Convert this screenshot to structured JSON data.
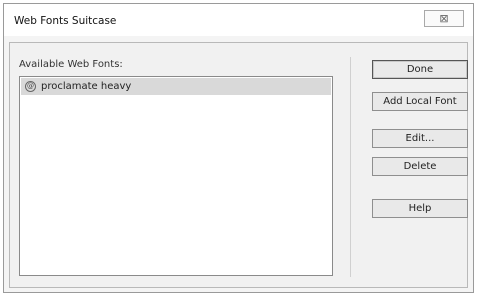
{
  "window": {
    "title": "Web Fonts Suitcase",
    "close_glyph": "⊠"
  },
  "list": {
    "label": "Available Web Fonts:",
    "items": [
      {
        "label": "proclamate heavy",
        "icon": "web-font-icon",
        "selected": true
      }
    ]
  },
  "buttons": {
    "done": "Done",
    "add_local_font": "Add Local Font",
    "edit": "Edit...",
    "delete": "Delete",
    "help": "Help"
  }
}
